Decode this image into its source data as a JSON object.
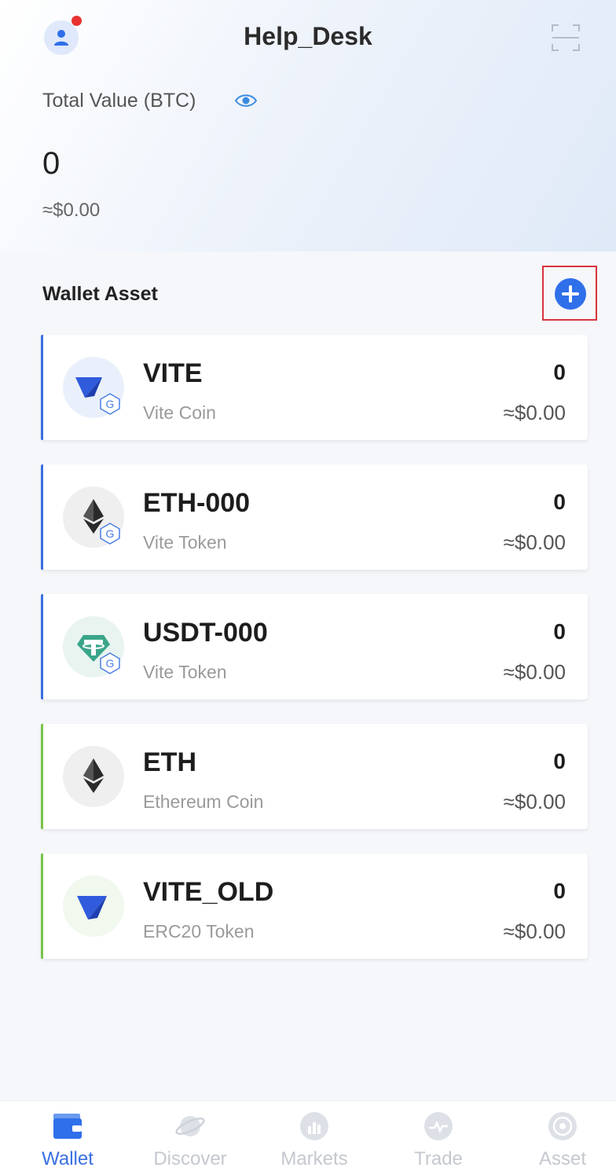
{
  "header": {
    "title": "Help_Desk",
    "avatar_icon": "user-icon",
    "scan_icon": "scan-icon"
  },
  "summary": {
    "label": "Total Value (BTC)",
    "value": "0",
    "usd": "≈$0.00"
  },
  "wallet": {
    "section_title": "Wallet Asset",
    "add_icon": "plus-circle-icon",
    "assets": [
      {
        "symbol": "VITE",
        "name": "Vite Coin",
        "amount": "0",
        "usd": "≈$0.00",
        "accent": "#3a6fe0",
        "badge": "G"
      },
      {
        "symbol": "ETH-000",
        "name": "Vite Token",
        "amount": "0",
        "usd": "≈$0.00",
        "accent": "#3a6fe0",
        "badge": "G"
      },
      {
        "symbol": "USDT-000",
        "name": "Vite Token",
        "amount": "0",
        "usd": "≈$0.00",
        "accent": "#3a6fe0",
        "badge": "G"
      },
      {
        "symbol": "ETH",
        "name": "Ethereum Coin",
        "amount": "0",
        "usd": "≈$0.00",
        "accent": "#79c24a"
      },
      {
        "symbol": "VITE_OLD",
        "name": "ERC20 Token",
        "amount": "0",
        "usd": "≈$0.00",
        "accent": "#79c24a"
      }
    ]
  },
  "tabs": [
    {
      "label": "Wallet",
      "icon": "wallet-icon",
      "active": true
    },
    {
      "label": "Discover",
      "icon": "planet-icon",
      "active": false
    },
    {
      "label": "Markets",
      "icon": "chart-icon",
      "active": false
    },
    {
      "label": "Trade",
      "icon": "trade-icon",
      "active": false
    },
    {
      "label": "Asset",
      "icon": "asset-icon",
      "active": false
    }
  ],
  "colors": {
    "accent": "#3a6fe0",
    "inactive_tab": "#c4c8cf",
    "vite_blue": "#2f5bdc",
    "usdt_green": "#3aa58a"
  }
}
